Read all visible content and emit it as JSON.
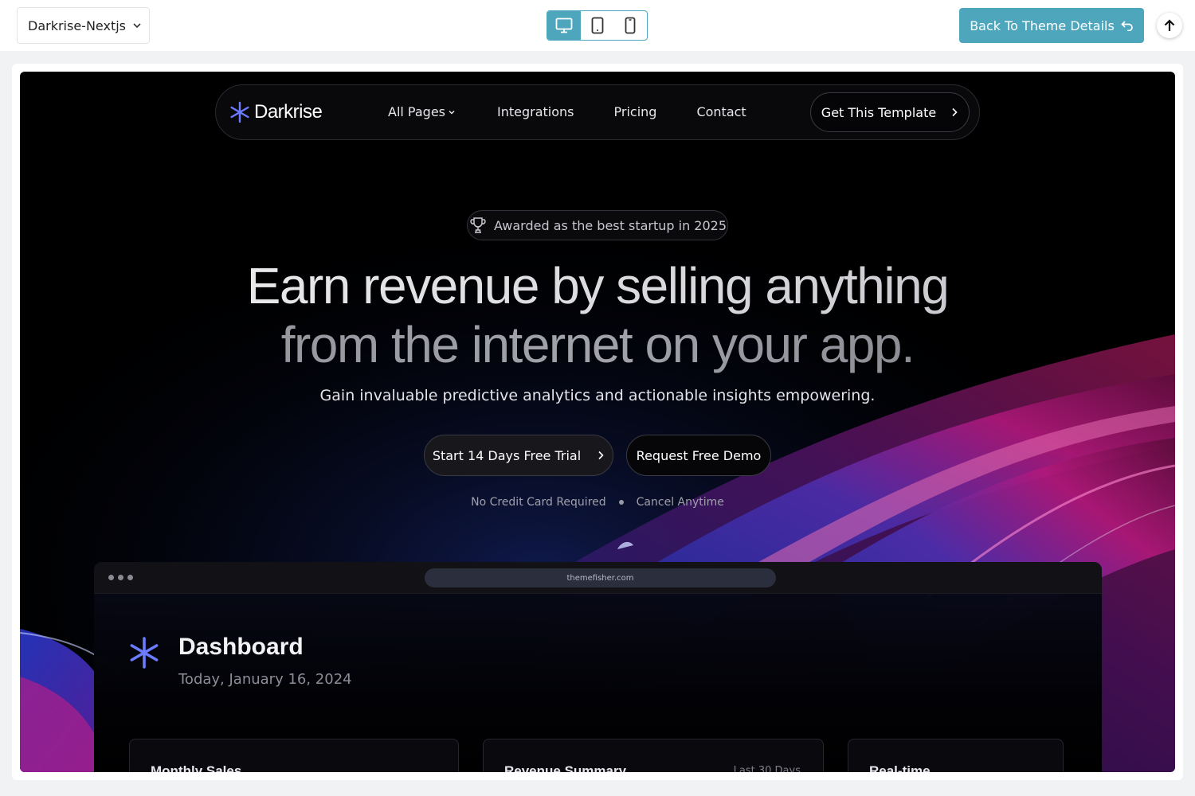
{
  "topbar": {
    "theme_select": "Darkrise-Nextjs",
    "devices": [
      "desktop-icon",
      "tablet-icon",
      "mobile-icon"
    ],
    "active_device": "desktop",
    "back_button": "Back To Theme Details",
    "accent": "#4ea6bd"
  },
  "nav": {
    "brand": "Darkrise",
    "links": [
      "All Pages",
      "Integrations",
      "Pricing",
      "Contact"
    ],
    "cta": "Get This Template"
  },
  "hero": {
    "award": "Awarded as the best startup in 2025",
    "title_line1": "Earn revenue by selling anything",
    "title_line2": "from the internet on your app.",
    "subtitle": "Gain invaluable predictive analytics and actionable insights empowering.",
    "primary_button": "Start 14 Days Free Trial",
    "secondary_button": "Request Free Demo",
    "notes": [
      "No Credit Card Required",
      "Cancel Anytime"
    ]
  },
  "dashboard": {
    "url": "themefisher.com",
    "title": "Dashboard",
    "date": "Today, January 16, 2024",
    "cards": [
      {
        "title": "Monthly Sales",
        "meta": ""
      },
      {
        "title": "Revenue Summary",
        "meta": "Last 30 Days"
      },
      {
        "title": "Real-time",
        "meta": ""
      }
    ]
  },
  "colors": {
    "brand_star": "#6b7cff",
    "site_bg": "#000000"
  }
}
